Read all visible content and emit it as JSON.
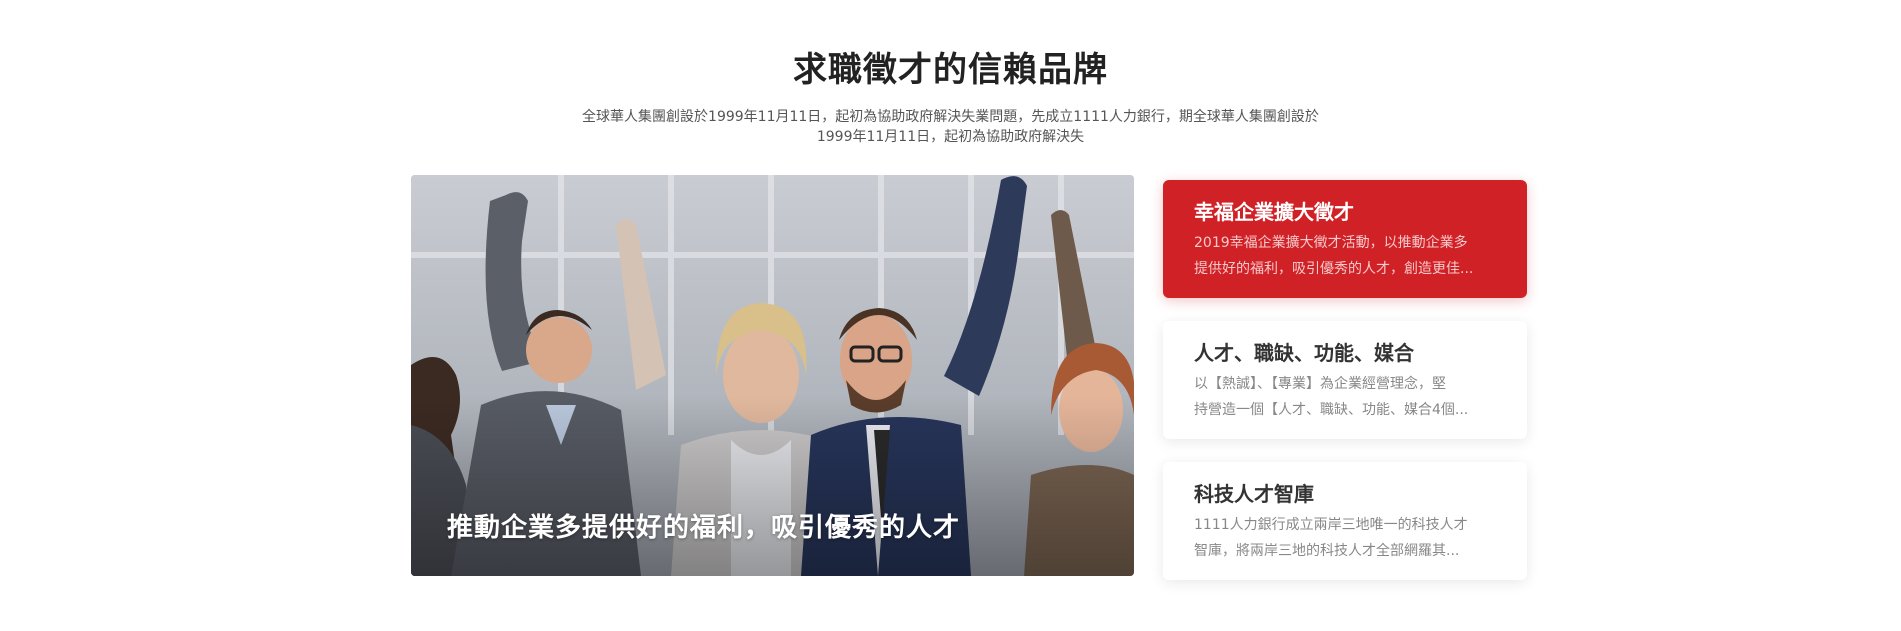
{
  "section": {
    "title": "求職徵才的信賴品牌",
    "description": "全球華人集團創設於1999年11月11日，起初為協助政府解決失業問題，先成立1111人力銀行，期全球華人集團創設於1999年11月11日，起初為協助政府解決失"
  },
  "hero": {
    "caption": "推動企業多提供好的福利，吸引優秀的人才",
    "image": "people-celebrating-office-photo"
  },
  "cards": [
    {
      "title": "幸福企業擴大徵才",
      "line1": "2019幸福企業擴大徵才活動，以推動企業多",
      "line2": "提供好的福利，吸引優秀的人才，創造更佳...",
      "active": true
    },
    {
      "title": "人才、職缺、功能、媒合",
      "line1": "以【熱誠】、【專業】為企業經營理念，堅",
      "line2": "持營造一個【人才、職缺、功能、媒合4個...",
      "active": false
    },
    {
      "title": "科技人才智庫",
      "line1": "1111人力銀行成立兩岸三地唯一的科技人才",
      "line2": "智庫，將兩岸三地的科技人才全部網羅其...",
      "active": false
    }
  ],
  "colors": {
    "accent": "#d02127",
    "card_bg": "#ffffff",
    "title_text": "#222222",
    "body_text": "#888888"
  }
}
